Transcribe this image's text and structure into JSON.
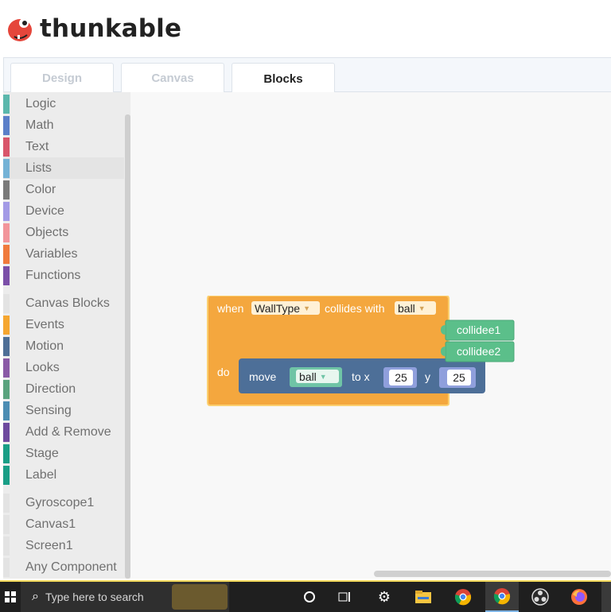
{
  "app": {
    "name": "thunkable"
  },
  "tabs": [
    {
      "label": "Design"
    },
    {
      "label": "Canvas"
    },
    {
      "label": "Blocks"
    }
  ],
  "toolbox": {
    "categories": [
      {
        "label": "Logic",
        "color": "#5bb7ac"
      },
      {
        "label": "Math",
        "color": "#5b7fc9"
      },
      {
        "label": "Text",
        "color": "#d9556a"
      },
      {
        "label": "Lists",
        "color": "#74b2d6"
      },
      {
        "label": "Color",
        "color": "#7a7a7a"
      },
      {
        "label": "Device",
        "color": "#a39ae6"
      },
      {
        "label": "Objects",
        "color": "#f2959a"
      },
      {
        "label": "Variables",
        "color": "#f07a3c"
      },
      {
        "label": "Functions",
        "color": "#7b4fa8"
      }
    ],
    "canvas_blocks": [
      {
        "label": "Canvas Blocks",
        "color": "#e3e3e3"
      },
      {
        "label": "Events",
        "color": "#f5a630"
      },
      {
        "label": "Motion",
        "color": "#4e6e96"
      },
      {
        "label": "Looks",
        "color": "#8a5aa6"
      },
      {
        "label": "Direction",
        "color": "#5aa37e"
      },
      {
        "label": "Sensing",
        "color": "#4c8db3"
      },
      {
        "label": "Add & Remove",
        "color": "#6e4a9e"
      },
      {
        "label": "Stage",
        "color": "#199e86"
      },
      {
        "label": "Label",
        "color": "#199e86"
      }
    ],
    "components": [
      {
        "label": "Gyroscope1",
        "color": "#e3e3e3"
      },
      {
        "label": "Canvas1",
        "color": "#e3e3e3"
      },
      {
        "label": "Screen1",
        "color": "#e3e3e3"
      },
      {
        "label": "Any Component",
        "color": "#e3e3e3"
      }
    ]
  },
  "event_block": {
    "when": "when",
    "sprite": "WallType",
    "collides_with": "collides with",
    "target": "ball",
    "param1": "collidee1",
    "param2": "collidee2",
    "do": "do",
    "color": "#f4a73e"
  },
  "move_block": {
    "move": "move",
    "sprite": "ball",
    "to_x": "to x",
    "x": "25",
    "y_label": "y",
    "y": "25",
    "color": "#4d6f98"
  },
  "taskbar": {
    "search_placeholder": "Type here to search"
  }
}
